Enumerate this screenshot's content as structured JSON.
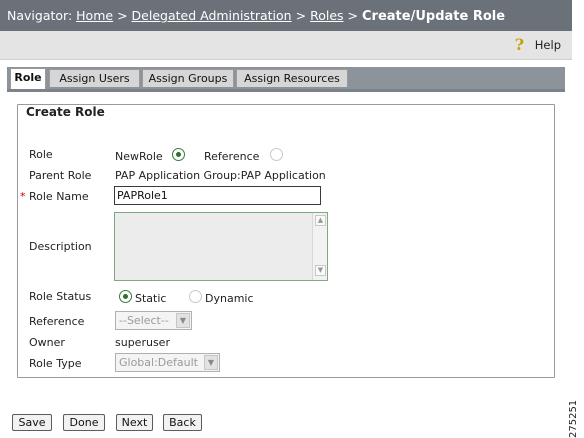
{
  "nav": {
    "prefix": "Navigator:",
    "breadcrumbs": [
      "Home",
      "Delegated Administration",
      "Roles"
    ],
    "separator": ">",
    "current": "Create/Update Role"
  },
  "help": {
    "label": "Help",
    "icon": "help-icon"
  },
  "tabs": [
    {
      "label": "Role",
      "active": true
    },
    {
      "label": "Assign Users",
      "active": false
    },
    {
      "label": "Assign Groups",
      "active": false
    },
    {
      "label": "Assign Resources",
      "active": false
    }
  ],
  "form": {
    "legend": "Create Role",
    "role": {
      "label": "Role",
      "option_new": "NewRole",
      "option_reference": "Reference",
      "selected": "NewRole"
    },
    "parent_role": {
      "label": "Parent Role",
      "value": "PAP Application Group:PAP Application"
    },
    "role_name": {
      "required_mark": "*",
      "label": "Role Name",
      "value": "PAPRole1"
    },
    "description": {
      "label": "Description",
      "value": ""
    },
    "role_status": {
      "label": "Role Status",
      "option_static": "Static",
      "option_dynamic": "Dynamic",
      "selected": "Static"
    },
    "reference": {
      "label": "Reference",
      "value": "--Select--"
    },
    "owner": {
      "label": "Owner",
      "value": "superuser"
    },
    "role_type": {
      "label": "Role Type",
      "value": "Global:Default"
    }
  },
  "buttons": {
    "save": "Save",
    "done": "Done",
    "next": "Next",
    "back": "Back"
  },
  "figure_id": "275251"
}
